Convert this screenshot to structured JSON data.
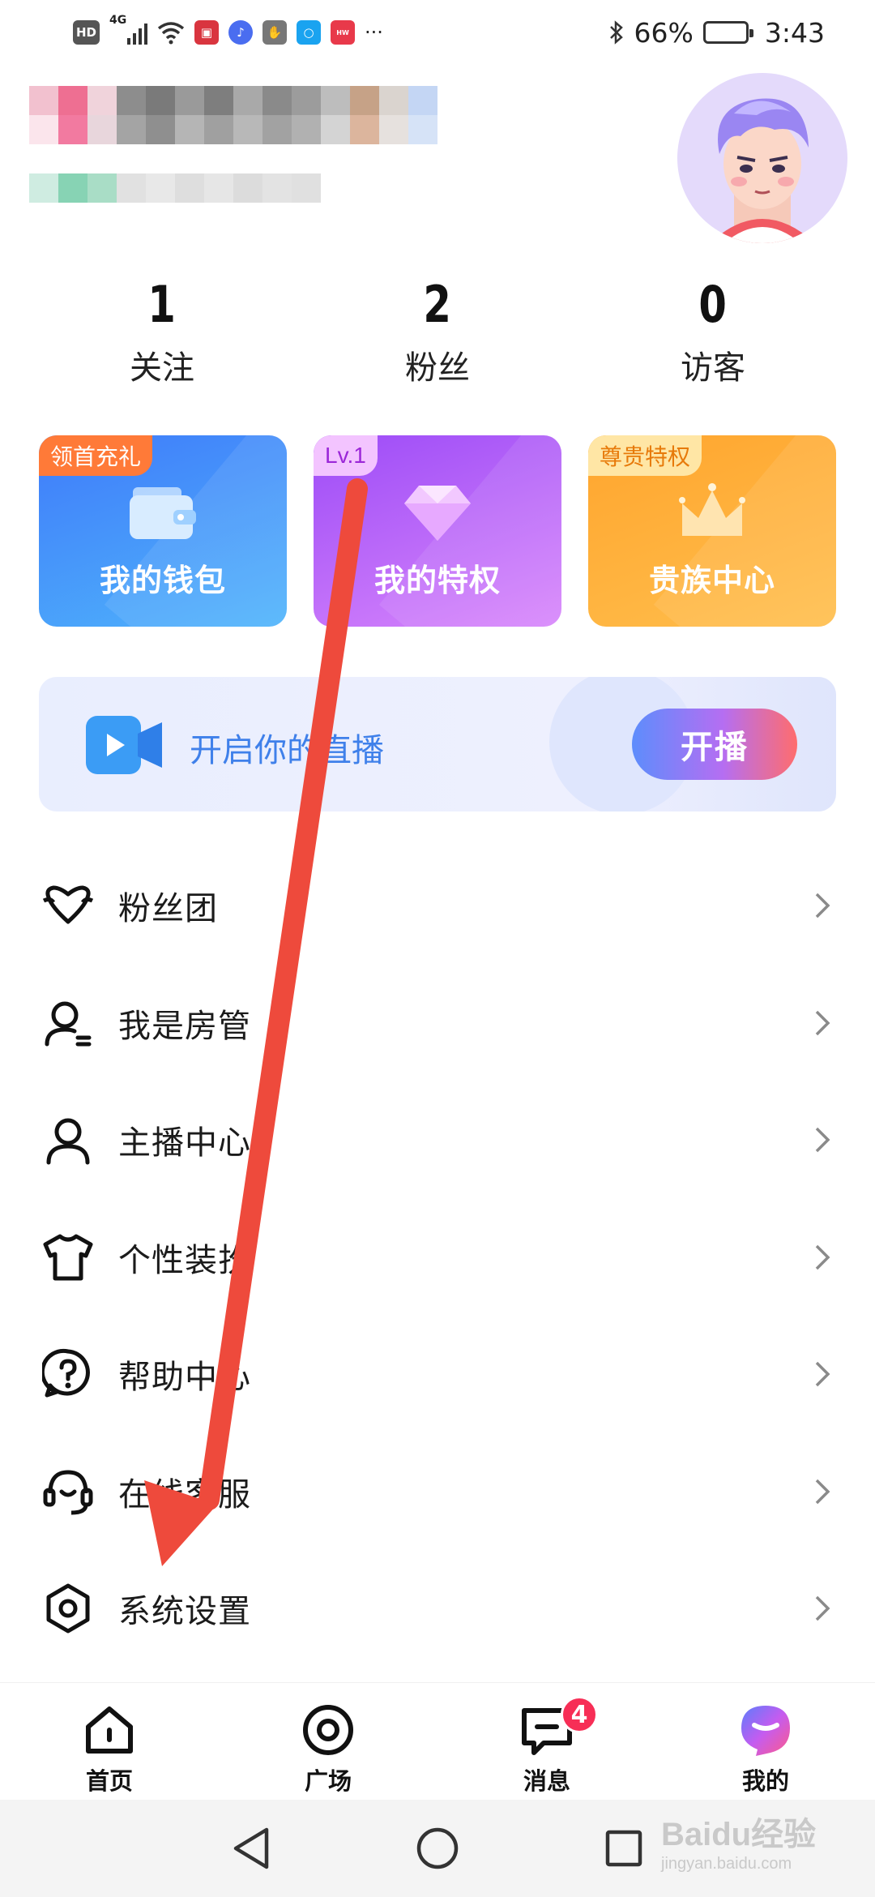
{
  "status_bar": {
    "network_label": "HD",
    "signal_label": "4G",
    "battery_percent": "66%",
    "battery_level": 0.66,
    "time": "3:43",
    "overflow": "···",
    "notification_icons": [
      "book-app-icon",
      "music-app-icon",
      "gesture-app-icon",
      "search-app-icon",
      "huawei-app-icon"
    ]
  },
  "profile": {
    "name": "",
    "avatar_icon": "cartoon-avatar-icon"
  },
  "stats": [
    {
      "value": "1",
      "label": "关注"
    },
    {
      "value": "2",
      "label": "粉丝"
    },
    {
      "value": "0",
      "label": "访客"
    }
  ],
  "cards": {
    "wallet": {
      "tag": "领首充礼",
      "label": "我的钱包",
      "icon": "wallet-icon"
    },
    "privilege": {
      "tag": "Lv.1",
      "label": "我的特权",
      "icon": "diamond-icon"
    },
    "noble": {
      "tag": "尊贵特权",
      "label": "贵族中心",
      "icon": "crown-icon"
    }
  },
  "live_banner": {
    "text": "开启你的直播",
    "button": "开播",
    "icon": "video-camera-icon"
  },
  "menu": [
    {
      "label": "粉丝团",
      "icon": "heart-badge-icon"
    },
    {
      "label": "我是房管",
      "icon": "room-manager-icon"
    },
    {
      "label": "主播中心",
      "icon": "user-icon"
    },
    {
      "label": "个性装扮",
      "icon": "tshirt-icon"
    },
    {
      "label": "帮助中心",
      "icon": "help-icon"
    },
    {
      "label": "在线客服",
      "icon": "headset-icon"
    },
    {
      "label": "系统设置",
      "icon": "settings-hexagon-icon"
    }
  ],
  "tabs": [
    {
      "label": "首页",
      "icon": "home-icon"
    },
    {
      "label": "广场",
      "icon": "target-icon"
    },
    {
      "label": "消息",
      "icon": "message-icon",
      "badge": "4"
    },
    {
      "label": "我的",
      "icon": "me-icon"
    }
  ],
  "watermark": {
    "main": "Baidu经验",
    "sub": "jingyan.baidu.com"
  },
  "colors": {
    "annotation_arrow": "#ee4a3c",
    "accent_blue": "#3f80ea",
    "badge_red": "#f72e56"
  }
}
